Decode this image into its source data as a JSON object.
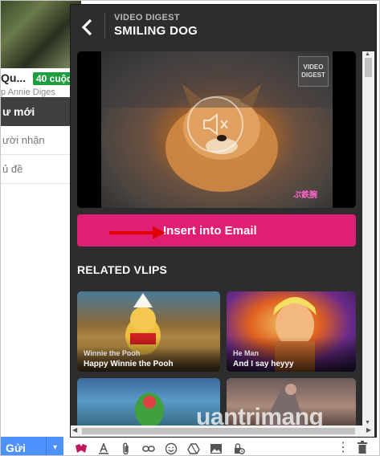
{
  "background": {
    "contact_name": "Qu...",
    "contact_badge": "40 cuộc",
    "contact_sub": "p Annie Diges",
    "compose_header": "ư mới",
    "field_to": "ười nhận",
    "field_subject": "ủ đề",
    "send_label": "Gửi",
    "send_dropdown": "▾",
    "toolbar_icons": [
      "vlip-icon",
      "text-format-icon",
      "attach-icon",
      "link-icon",
      "emoji-icon",
      "drive-icon",
      "image-icon",
      "confidential-icon",
      "more-options-icon",
      "trash-icon"
    ],
    "more_label": "⋮"
  },
  "panel": {
    "kicker": "VIDEO DIGEST",
    "title": "SMILING DOG",
    "video": {
      "watermark": "VIDEO DIGEST",
      "logo": "ぷ鉄腕"
    },
    "insert_label": "Insert into Email",
    "related_title": "RELATED VLIPS",
    "related": [
      {
        "kicker": "Winnie the Pooh",
        "title": "Happy Winnie the Pooh"
      },
      {
        "kicker": "He Man",
        "title": "And I say heyyy"
      },
      {
        "kicker": "",
        "title": ""
      },
      {
        "kicker": "",
        "title": ""
      }
    ]
  },
  "watermark_text": "uantrimang",
  "colors": {
    "panel_bg": "#2d2d2d",
    "insert_button": "#e01e74",
    "send_button": "#4d90fe",
    "arrow": "#e00000"
  }
}
